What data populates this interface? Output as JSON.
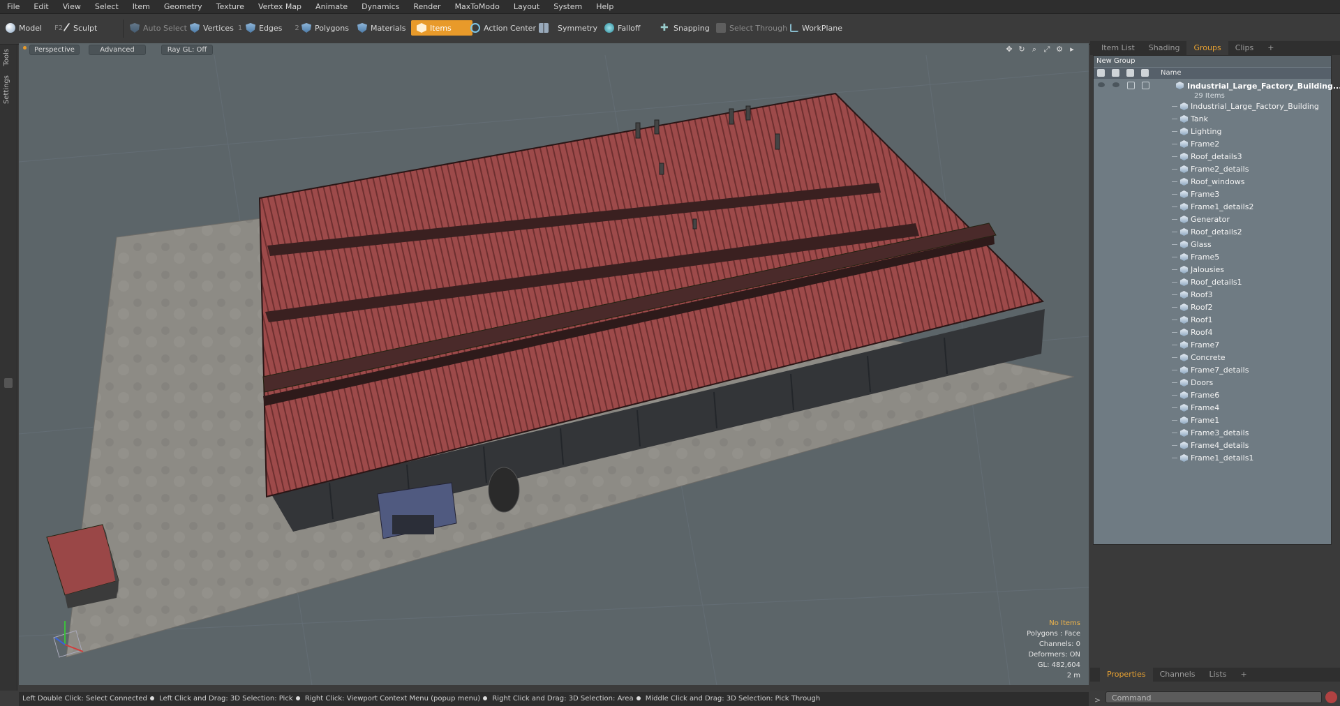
{
  "menu": [
    "File",
    "Edit",
    "View",
    "Select",
    "Item",
    "Geometry",
    "Texture",
    "Vertex Map",
    "Animate",
    "Dynamics",
    "Render",
    "MaxToModo",
    "Layout",
    "System",
    "Help"
  ],
  "toolbar": {
    "model": "Model",
    "model_key": "F2",
    "sculpt": "Sculpt",
    "auto_select": "Auto Select",
    "vertices": "Vertices",
    "vertices_num": "1",
    "edges": "Edges",
    "edges_num": "2",
    "polygons": "Polygons",
    "materials": "Materials",
    "items": "Items",
    "action_center": "Action Center",
    "symmetry": "Symmetry",
    "falloff": "Falloff",
    "snapping": "Snapping",
    "select_through": "Select Through",
    "workplane": "WorkPlane",
    "accent": "#e89a2a"
  },
  "left_tabs": [
    "Tools",
    "Settings"
  ],
  "viewport": {
    "view": "Perspective",
    "shading": "Advanced",
    "raygl": "Ray GL: Off",
    "info": {
      "no_items": "No Items",
      "polygons": "Polygons : Face",
      "channels": "Channels: 0",
      "deformers": "Deformers: ON",
      "gl": "GL: 482,604",
      "scale": "2 m"
    }
  },
  "right_panel": {
    "tabs": [
      "Item List",
      "Shading",
      "Groups",
      "Clips"
    ],
    "active_tab": "Groups",
    "new_group": "New Group",
    "name_col": "Name",
    "group_name": "Industrial_Large_Factory_Building...",
    "group_count": "29 Items",
    "items": [
      "Industrial_Large_Factory_Building",
      "Tank",
      "Lighting",
      "Frame2",
      "Roof_details3",
      "Frame2_details",
      "Roof_windows",
      "Frame3",
      "Frame1_details2",
      "Generator",
      "Roof_details2",
      "Glass",
      "Frame5",
      "Jalousies",
      "Roof_details1",
      "Roof3",
      "Roof2",
      "Roof1",
      "Roof4",
      "Frame7",
      "Concrete",
      "Frame7_details",
      "Doors",
      "Frame6",
      "Frame4",
      "Frame1",
      "Frame3_details",
      "Frame4_details",
      "Frame1_details1"
    ],
    "bottom_tabs": [
      "Properties",
      "Channels",
      "Lists"
    ],
    "command_placeholder": "Command"
  },
  "status": {
    "hint1": "Left Double Click: Select Connected",
    "hint2": "Left Click and Drag: 3D Selection: Pick",
    "hint3": "Right Click: Viewport Context Menu (popup menu)",
    "hint4": "Right Click and Drag: 3D Selection: Area",
    "hint5": "Middle Click and Drag: 3D Selection: Pick Through"
  }
}
